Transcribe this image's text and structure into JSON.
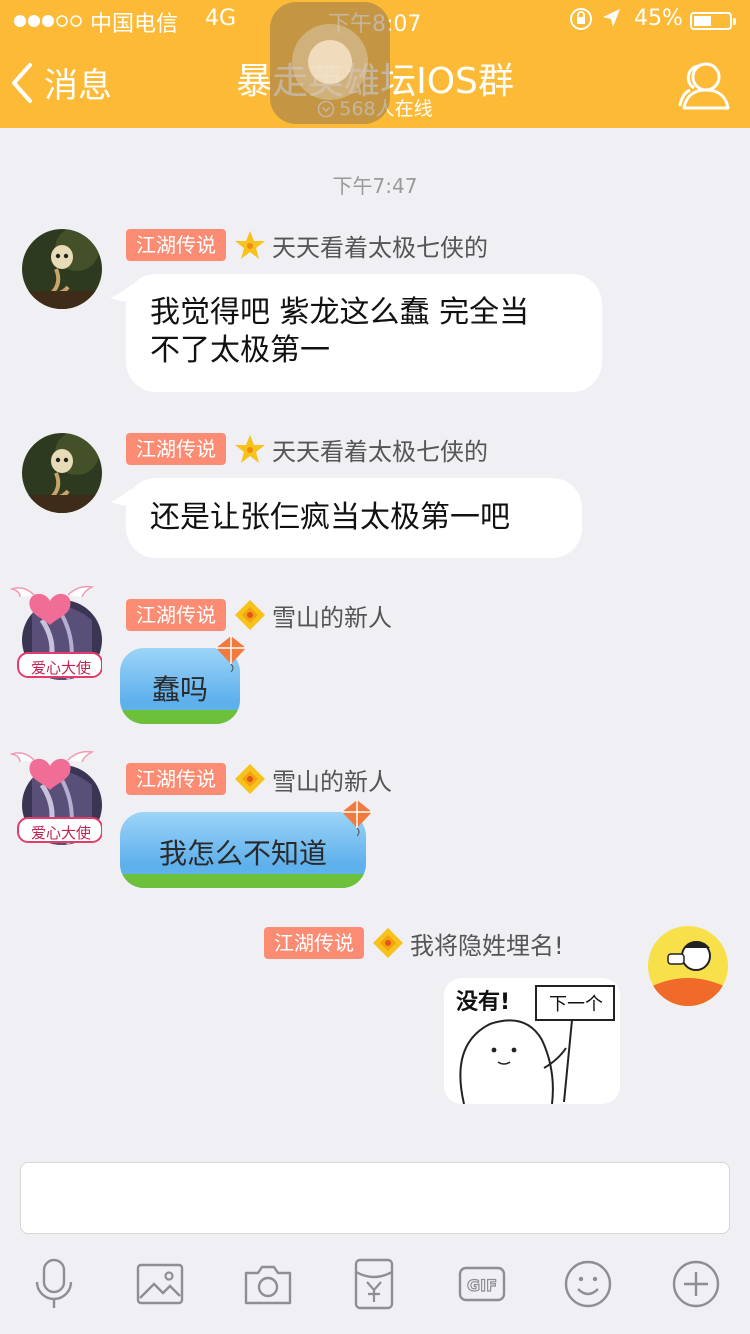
{
  "status_bar": {
    "carrier": "中国电信",
    "network": "4G",
    "time": "下午8:07",
    "battery": "45%",
    "battery_level": 0.45
  },
  "nav": {
    "back_label": "消息",
    "title": "暴走英雄坛IOS群",
    "online": "568人在线"
  },
  "chat": {
    "timestamp": "下午7:47",
    "messages": [
      {
        "badge": "江湖传说",
        "sender": "天天看着太极七侠的",
        "text_line1": "我觉得吧 紫龙这么蠢 完全当",
        "text_line2": "不了太极第一"
      },
      {
        "badge": "江湖传说",
        "sender": "天天看着太极七侠的",
        "text": "还是让张仨疯当太极第一吧"
      },
      {
        "badge": "江湖传说",
        "sender": "雪山的新人",
        "text": "蠢吗",
        "avatar_frame_text": "爱心大使"
      },
      {
        "badge": "江湖传说",
        "sender": "雪山的新人",
        "text": "我怎么不知道",
        "avatar_frame_text": "爱心大使"
      },
      {
        "badge": "江湖传说",
        "sender": "我将隐姓埋名!",
        "sticker_text1": "没有!",
        "sticker_text2": "下一个"
      }
    ]
  },
  "colors": {
    "nav_bg": "#fdba36",
    "badge_bg": "#fb8c73",
    "chat_bg": "#efeff4"
  },
  "toolbar": {
    "icons": [
      "mic-icon",
      "image-icon",
      "camera-icon",
      "red-packet-icon",
      "gif-icon",
      "emoji-icon",
      "plus-icon"
    ]
  }
}
